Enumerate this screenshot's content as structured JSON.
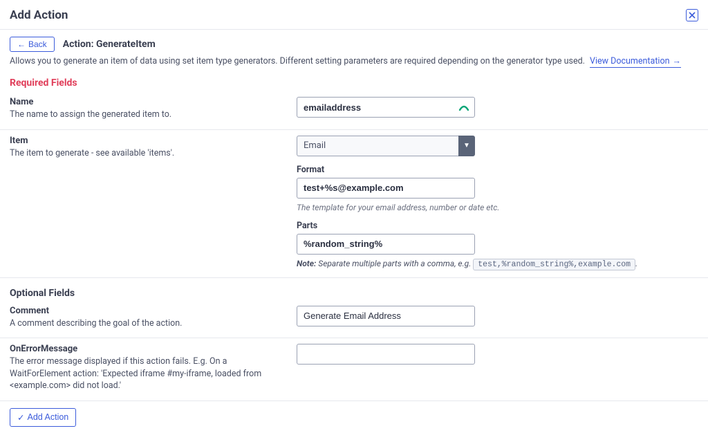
{
  "header": {
    "title": "Add Action"
  },
  "subheader": {
    "back_label": "Back",
    "action_title": "Action: GenerateItem"
  },
  "description": {
    "text": "Allows you to generate an item of data using set item type generators. Different setting parameters are required depending on the generator type used.",
    "doc_link": "View Documentation"
  },
  "sections": {
    "required": "Required Fields",
    "optional": "Optional Fields"
  },
  "fields": {
    "name": {
      "label": "Name",
      "desc": "The name to assign the generated item to.",
      "value": "emailaddress"
    },
    "item": {
      "label": "Item",
      "desc": "The item to generate - see available 'items'.",
      "selected": "Email",
      "format_label": "Format",
      "format_value": "test+%s@example.com",
      "format_hint": "The template for your email address, number or date etc.",
      "parts_label": "Parts",
      "parts_value": "%random_string%",
      "parts_note_prefix": "Note:",
      "parts_note_text": " Separate multiple parts with a comma, e.g. ",
      "parts_note_code": "test,%random_string%,example.com",
      "parts_note_suffix": "."
    },
    "comment": {
      "label": "Comment",
      "desc": "A comment describing the goal of the action.",
      "value": "Generate Email Address"
    },
    "onerror": {
      "label": "OnErrorMessage",
      "desc": "The error message displayed if this action fails. E.g. On a WaitForElement action: 'Expected iframe #my-iframe, loaded from <example.com> did not load.'",
      "value": ""
    }
  },
  "footer": {
    "add_label": "Add Action"
  }
}
